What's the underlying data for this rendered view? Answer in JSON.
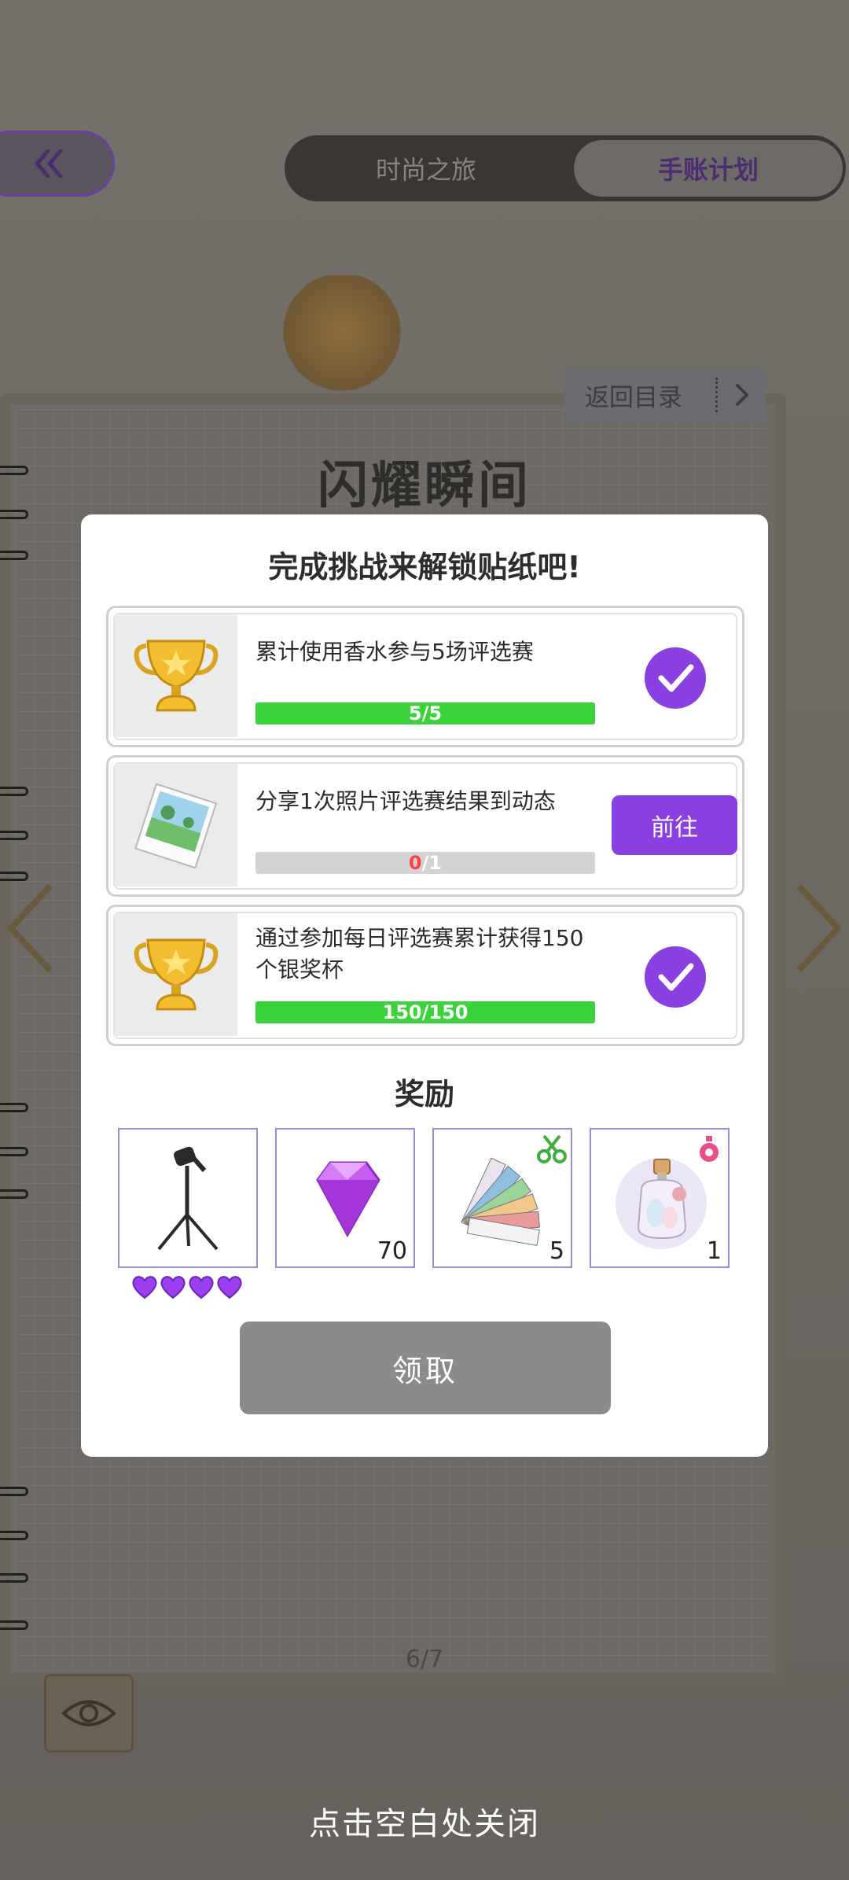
{
  "top_nav": {
    "tabs": [
      {
        "label": "时尚之旅",
        "active": false
      },
      {
        "label": "手账计划",
        "active": true
      }
    ]
  },
  "notebook": {
    "return_label": "返回目录",
    "page_heading": "闪耀瞬间",
    "page_number": "6/7"
  },
  "modal": {
    "title": "完成挑战来解锁贴纸吧!",
    "tasks": [
      {
        "text": "累计使用香水参与5场评选赛",
        "current": "5",
        "target": "5",
        "progress": 1.0,
        "status": "completed",
        "icon": "trophy-icon"
      },
      {
        "text": "分享1次照片评选赛结果到动态",
        "current": "0",
        "target": "1",
        "progress": 0.0,
        "status": "pending",
        "action_label": "前往",
        "icon": "photo-icon"
      },
      {
        "text": "通过参加每日评选赛累计获得150个银奖杯",
        "current": "150",
        "target": "150",
        "progress": 1.0,
        "status": "completed",
        "icon": "trophy-icon"
      }
    ],
    "rewards_title": "奖励",
    "rewards": [
      {
        "icon": "spotlight-stand-icon",
        "count": "",
        "rating": 4
      },
      {
        "icon": "purple-diamond-icon",
        "count": "70"
      },
      {
        "icon": "color-swatch-icon",
        "count": "5",
        "badge": "scissors-icon"
      },
      {
        "icon": "perfume-bottle-icon",
        "count": "1",
        "badge": "perfume-icon"
      }
    ],
    "claim_label": "领取"
  },
  "close_hint": "点击空白处关闭",
  "colors": {
    "accent_purple": "#8a3fe0",
    "progress_green": "#3cd23c",
    "disabled_gray": "#8b8b8b"
  }
}
